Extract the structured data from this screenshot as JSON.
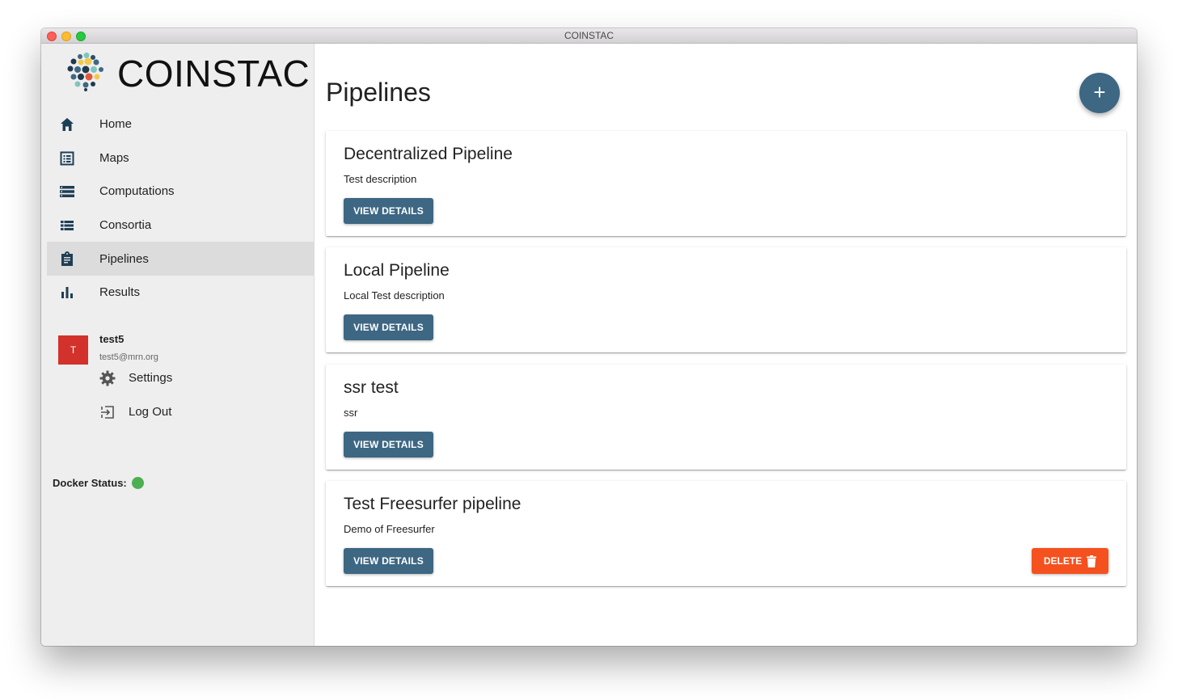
{
  "window": {
    "title": "COINSTAC"
  },
  "brand": {
    "name": "COINSTAC"
  },
  "nav": {
    "items": [
      {
        "label": "Home",
        "icon": "home-icon"
      },
      {
        "label": "Maps",
        "icon": "list-alt-icon"
      },
      {
        "label": "Computations",
        "icon": "storage-icon"
      },
      {
        "label": "Consortia",
        "icon": "list-icon"
      },
      {
        "label": "Pipelines",
        "icon": "clipboard-icon",
        "active": true
      },
      {
        "label": "Results",
        "icon": "bar-chart-icon"
      }
    ]
  },
  "user": {
    "initial": "T",
    "name": "test5",
    "email": "test5@mrn.org",
    "settings_label": "Settings",
    "logout_label": "Log Out"
  },
  "docker": {
    "label": "Docker Status:",
    "status_color": "#4caf50"
  },
  "main": {
    "title": "Pipelines",
    "add_label": "+",
    "view_label": "VIEW DETAILS",
    "delete_label": "DELETE",
    "pipelines": [
      {
        "name": "Decentralized Pipeline",
        "description": "Test description"
      },
      {
        "name": "Local Pipeline",
        "description": "Local Test description"
      },
      {
        "name": "ssr test",
        "description": "ssr"
      },
      {
        "name": "Test Freesurfer pipeline",
        "description": "Demo of Freesurfer",
        "deletable": true
      }
    ]
  },
  "colors": {
    "accent": "#3d6783",
    "danger": "#f4511e",
    "avatar": "#d3312b"
  }
}
